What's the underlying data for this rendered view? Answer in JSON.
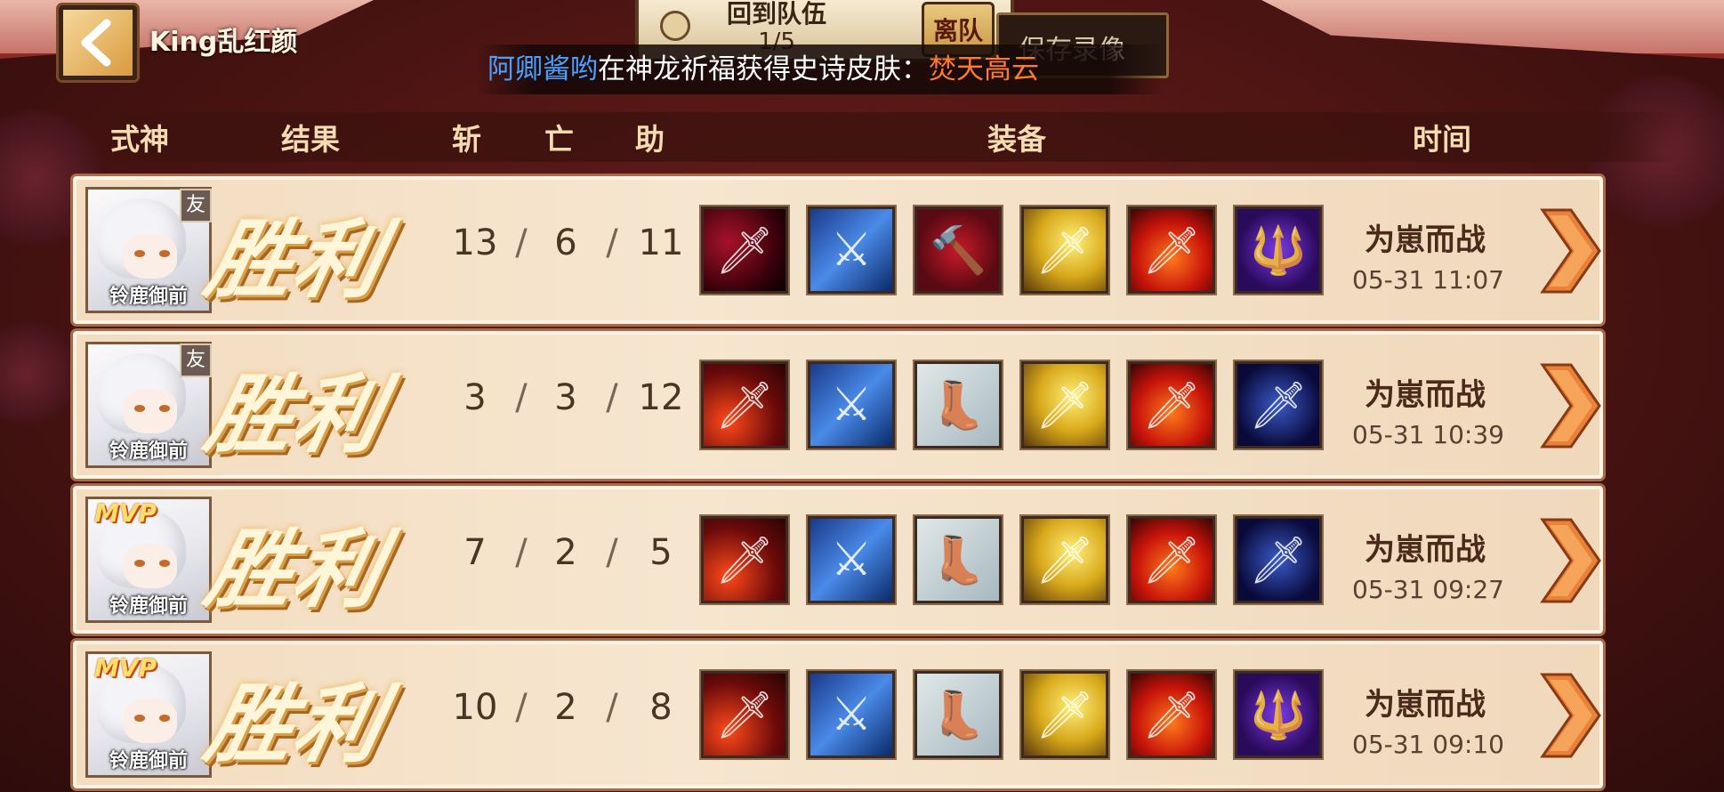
{
  "player": {
    "name": "King乱红颜"
  },
  "top_bar": {
    "return_team_label": "回到队伍",
    "team_count": "1/5",
    "leave_label": "离队",
    "save_replay_label": "保存录像"
  },
  "broadcast": {
    "player": "阿卿酱哟",
    "message": "在神龙祈福获得史诗皮肤：",
    "skin": "焚天高云"
  },
  "table_headers": {
    "shikigami": "式神",
    "result": "结果",
    "kills": "斩",
    "deaths": "亡",
    "assists": "助",
    "equipment": "装备",
    "time": "时间"
  },
  "matches": [
    {
      "shikigami": "铃鹿御前",
      "badge": "友",
      "result": "胜利",
      "kills": "13",
      "deaths": "6",
      "assists": "11",
      "equipment": [
        "dagger-black",
        "polearm-blue",
        "hammer-red",
        "katana-gold",
        "flame-sword",
        "spear-purple"
      ],
      "mode": "为崽而战",
      "time": "05-31 11:07"
    },
    {
      "shikigami": "铃鹿御前",
      "badge": "友",
      "result": "胜利",
      "kills": "3",
      "deaths": "3",
      "assists": "12",
      "equipment": [
        "claw-red",
        "polearm-blue",
        "boots-purple",
        "katana-gold",
        "flame-sword",
        "blade-ghost"
      ],
      "mode": "为崽而战",
      "time": "05-31 10:39"
    },
    {
      "shikigami": "铃鹿御前",
      "badge": "MVP",
      "result": "胜利",
      "kills": "7",
      "deaths": "2",
      "assists": "5",
      "equipment": [
        "claw-red",
        "polearm-blue",
        "boots-purple",
        "katana-gold",
        "flame-sword",
        "blade-ghost"
      ],
      "mode": "为崽而战",
      "time": "05-31 09:27"
    },
    {
      "shikigami": "铃鹿御前",
      "badge": "MVP",
      "result": "胜利",
      "kills": "10",
      "deaths": "2",
      "assists": "8",
      "equipment": [
        "claw-red",
        "polearm-blue",
        "boots-purple",
        "katana-gold",
        "flame-sword",
        "spear-purple"
      ],
      "mode": "为崽而战",
      "time": "05-31 09:10"
    }
  ],
  "separators": {
    "kda": "/"
  },
  "colors": {
    "broadcast_player": "#4aa0ff",
    "broadcast_skin": "#ff7a2a",
    "row_bg": "#f6e6cf"
  }
}
